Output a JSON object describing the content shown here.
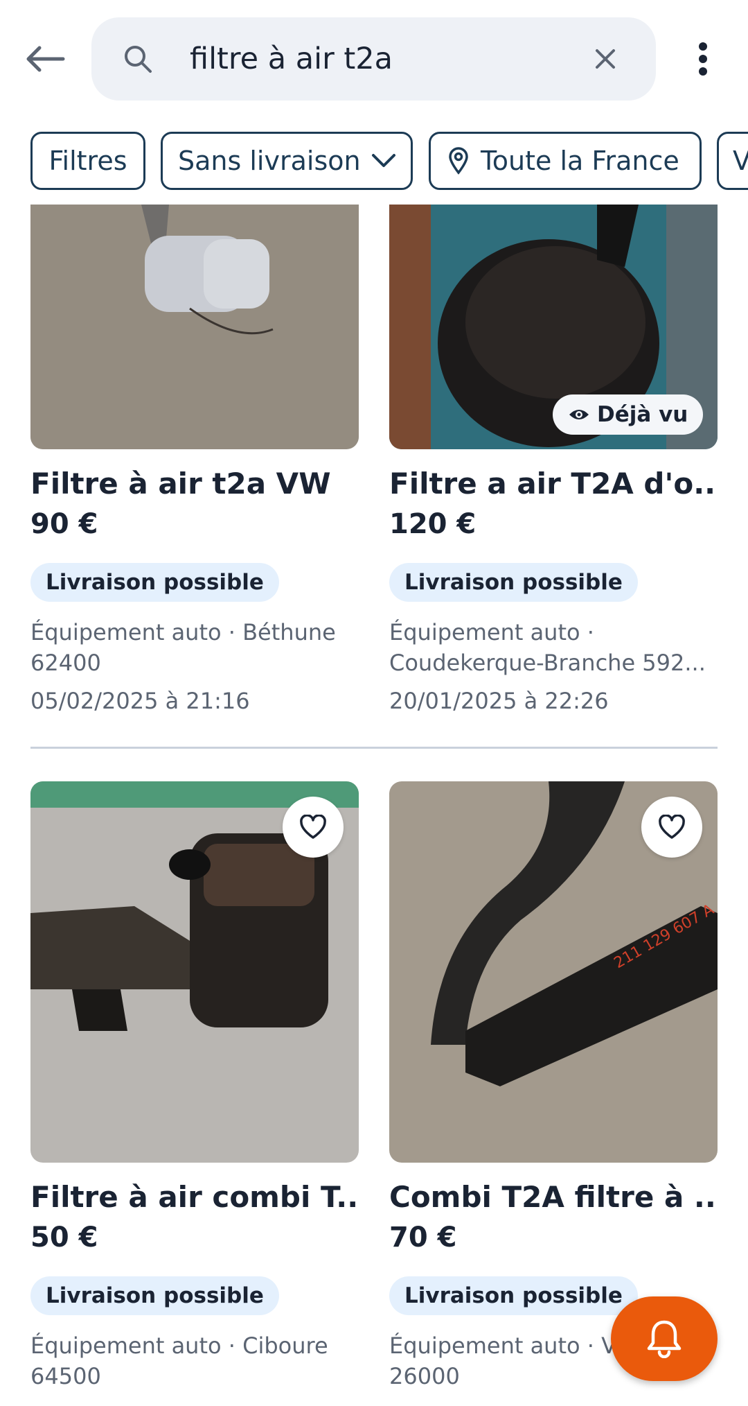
{
  "search": {
    "query": "filtre à air t2a"
  },
  "chips": [
    {
      "label": "Filtres"
    },
    {
      "label": "Sans livraison"
    },
    {
      "label": "Toute la France"
    },
    {
      "label": "V"
    }
  ],
  "listings": [
    {
      "title": "Filtre à air t2a VW",
      "price": "90 €",
      "badge": "Livraison possible",
      "category_location_line1": "Équipement auto · Béthune",
      "category_location_line2": "62400",
      "date": "05/02/2025 à 21:16"
    },
    {
      "title": "Filtre a air T2A d'o...",
      "price": "120 €",
      "badge": "Livraison possible",
      "category_location_line1": "Équipement auto ·",
      "category_location_line2": "Coudekerque-Branche 592...",
      "date": "20/01/2025 à 22:26",
      "seen_label": "Déjà vu"
    },
    {
      "title": "Filtre à air combi T...",
      "price": "50 €",
      "badge": "Livraison possible",
      "category_location_line1": "Équipement auto · Ciboure",
      "category_location_line2": "64500"
    },
    {
      "title": "Combi T2A filtre à ...",
      "price": "70 €",
      "badge": "Livraison possible",
      "category_location_line1": "Équipement auto · V",
      "category_location_line2": "26000"
    }
  ],
  "colors": {
    "accent": "#ea5a0c",
    "chip_border": "#1c3b55",
    "badge_bg": "#e4f0fd",
    "search_bg": "#eef1f6"
  },
  "icons": [
    "back-arrow-icon",
    "search-icon",
    "close-icon",
    "more-vert-icon",
    "chevron-down-icon",
    "location-pin-icon",
    "eye-icon",
    "heart-icon",
    "bell-icon"
  ]
}
